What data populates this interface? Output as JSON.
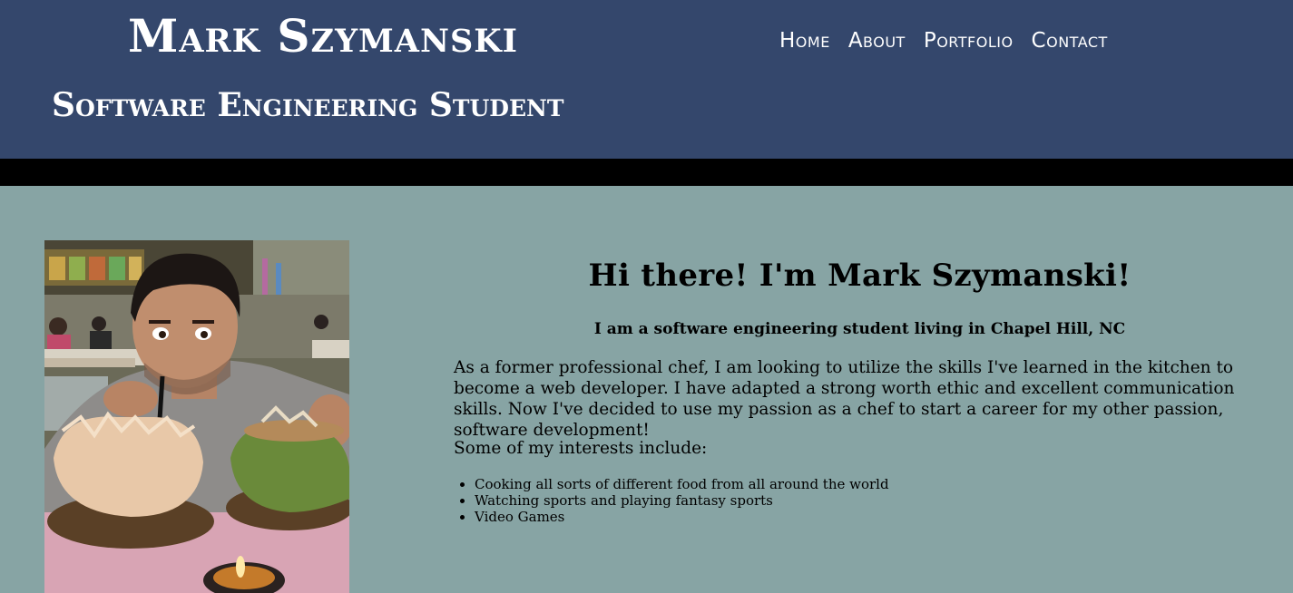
{
  "header": {
    "site_title": "Mark Szymanski",
    "subtitle": "Software Engineering Student",
    "background_color": "#34476c"
  },
  "nav": {
    "items": [
      {
        "label": "Home"
      },
      {
        "label": "About"
      },
      {
        "label": "Portfolio"
      },
      {
        "label": "Contact"
      }
    ]
  },
  "about": {
    "greeting": "Hi there! I'm Mark Szymanski!",
    "tagline": "I am a software engineering student living in Chapel Hill, NC",
    "bio": "As a former professional chef, I am looking to utilize the skills I've learned in the kitchen to become a web developer. I have adapted a strong worth ethic and excellent communication skills. Now I've decided to use my passion as a chef to start a career for my other passion, software development!",
    "interests_heading": "Some of my interests include:",
    "interests": [
      "Cooking all sorts of different food from all around the world",
      "Watching sports and playing fantasy sports",
      "Video Games"
    ]
  },
  "colors": {
    "page_background": "#87a4a4",
    "divider": "#000000"
  }
}
